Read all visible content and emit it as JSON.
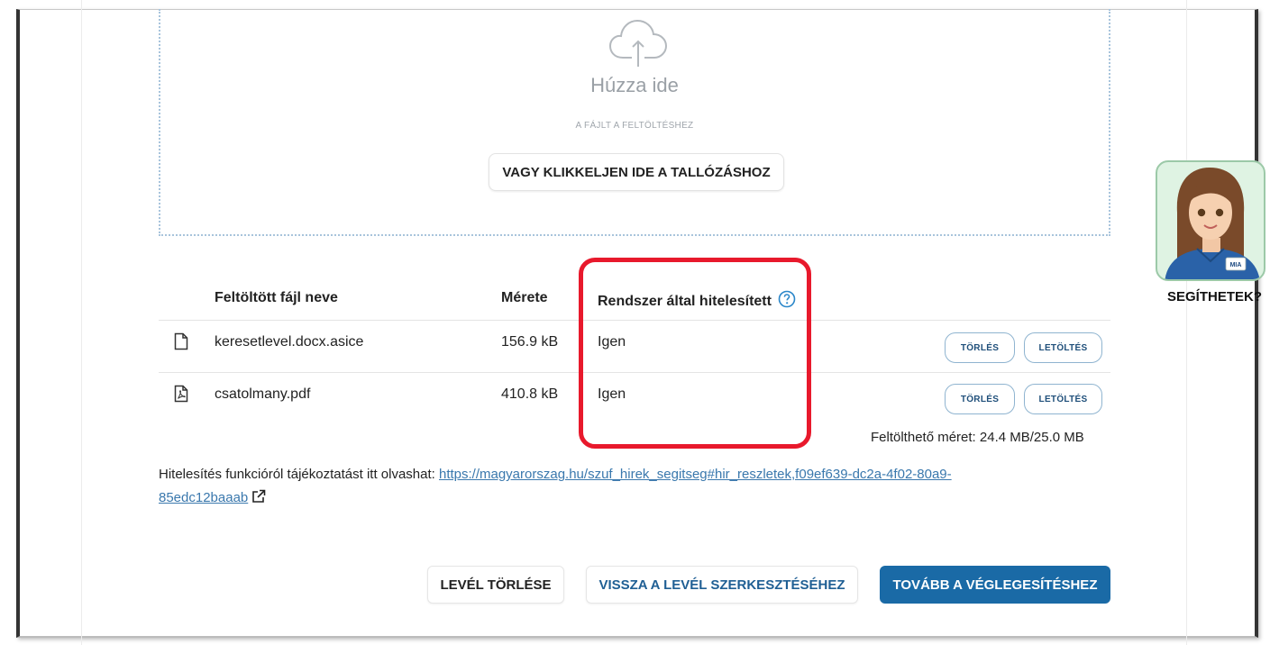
{
  "upload": {
    "drop_title": "Húzza ide",
    "drop_subtitle": "A FÁJLT A FELTÖLTÉSHEZ",
    "browse_label": "VAGY KLIKKELJEN IDE A TALLÓZÁSHOZ"
  },
  "table": {
    "headers": {
      "name": "Feltöltött fájl neve",
      "size": "Mérete",
      "verified": "Rendszer által hitelesített"
    },
    "rows": [
      {
        "icon": "document-icon",
        "name": "keresetlevel.docx.asice",
        "size": "156.9 kB",
        "verified": "Igen",
        "delete_label": "TÖRLÉS",
        "download_label": "LETÖLTÉS"
      },
      {
        "icon": "pdf-file-icon",
        "name": "csatolmany.pdf",
        "size": "410.8 kB",
        "verified": "Igen",
        "delete_label": "TÖRLÉS",
        "download_label": "LETÖLTÉS"
      }
    ],
    "quota": "Feltölthető méret: 24.4 MB/25.0 MB"
  },
  "info": {
    "text": "Hitelesítés funkcióról tájékoztatást itt olvashat: ",
    "link_line1": "https://magyarorszag.hu/szuf_hirek_segitseg#hir_reszletek,f09ef639-dc2a-4f02-80a9-",
    "link_line2": "85edc12baaab"
  },
  "actions": {
    "delete_letter": "LEVÉL TÖRLÉSE",
    "back_to_edit": "VISSZA A LEVÉL SZERKESZTÉSÉHEZ",
    "continue": "TOVÁBB A VÉGLEGESÍTÉSHEZ"
  },
  "assistant": {
    "badge_text": "MIA",
    "label": "SEGÍTHETEK?"
  },
  "colors": {
    "primary": "#1a6aa6",
    "highlight": "#e8192c",
    "link": "#3a78ad"
  }
}
